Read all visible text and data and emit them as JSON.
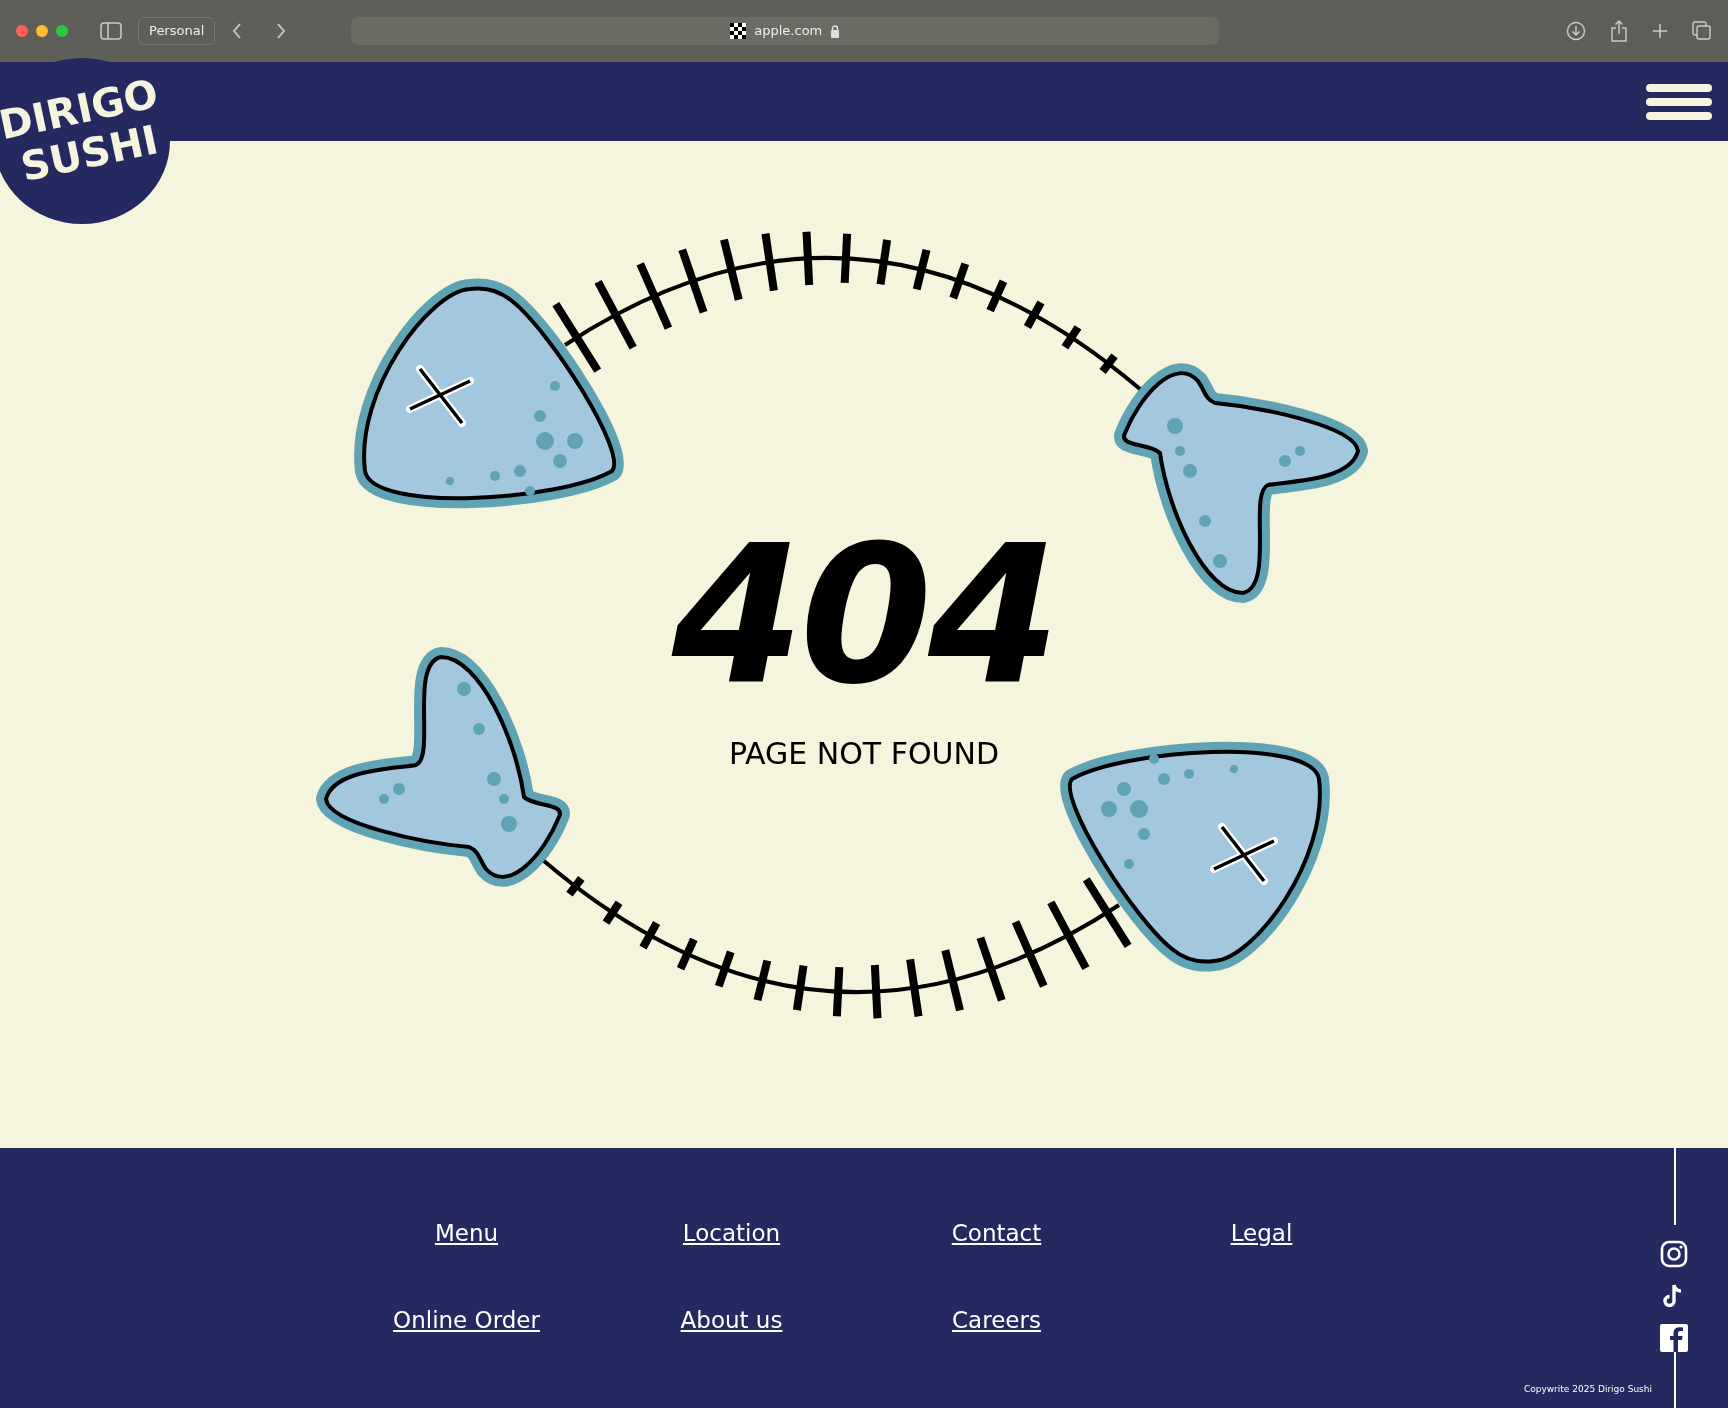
{
  "browser": {
    "profile": "Personal",
    "url": "apple.com"
  },
  "header": {
    "logo_lines": [
      "DIRIGO",
      "SUSHI"
    ]
  },
  "error": {
    "code": "404",
    "message": "PAGE NOT FOUND"
  },
  "footer": {
    "link_rows": [
      [
        "Menu",
        "Location",
        "Contact",
        "Legal"
      ],
      [
        "Online Order",
        "About us",
        "Careers"
      ]
    ],
    "copyright": "Copywrite 2025 Dirigo Sushi"
  }
}
